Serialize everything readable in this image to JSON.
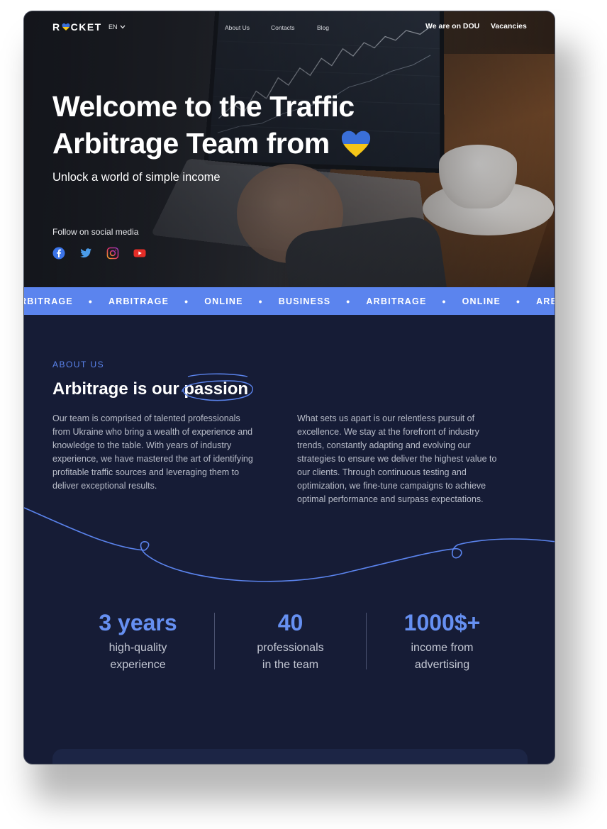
{
  "nav": {
    "logo": "R CKET",
    "lang": "EN",
    "links": [
      "About Us",
      "Contacts",
      "Blog"
    ],
    "dou": "We are on DOU",
    "vacancies": "Vacancies"
  },
  "hero": {
    "title": "Welcome to the Traffic Arbitrage Team from",
    "subtitle": "Unlock a world of simple income",
    "follow": "Follow on social media",
    "social_icons": [
      "facebook-icon",
      "twitter-icon",
      "instagram-icon",
      "youtube-icon"
    ]
  },
  "ticker": [
    "RBITRAGE",
    "ARBITRAGE",
    "ONLINE",
    "BUSINESS",
    "ARBITRAGE",
    "ONLINE",
    "ARBITR"
  ],
  "about": {
    "label": "ABOUT US",
    "title_start": "Arbitrage is our ",
    "title_highlight": "passion",
    "p1": "Our team is comprised of talented professionals from Ukraine who bring a wealth of experience and knowledge to the table. With years of industry experience, we have mastered the art of identifying profitable traffic sources and leveraging them to deliver exceptional results.",
    "p2": "What sets us apart is our relentless pursuit of excellence. We stay at the forefront of industry trends, constantly adapting and evolving our strategies to ensure we deliver the highest value to our clients. Through continuous testing and optimization, we fine-tune campaigns to achieve optimal performance and surpass expectations."
  },
  "stats": [
    {
      "value": "3 years",
      "l1": "high-quality",
      "l2": "experience"
    },
    {
      "value": "40",
      "l1": "professionals",
      "l2": "in the team"
    },
    {
      "value": "1000$+",
      "l1": "income from",
      "l2": "advertising"
    }
  ],
  "colors": {
    "accent": "#5b84ee",
    "background": "#161c36",
    "ukraine_blue": "#3a6fd8",
    "ukraine_yellow": "#f5c518"
  }
}
